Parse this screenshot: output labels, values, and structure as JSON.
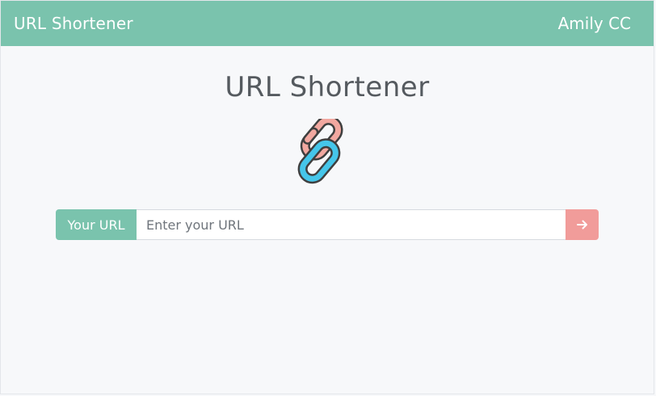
{
  "navbar": {
    "brand": "URL Shortener",
    "user_name": "Amily CC"
  },
  "main": {
    "title": "URL Shortener",
    "logo_icon": "chain-link-icon",
    "form": {
      "addon_label": "Your URL",
      "input_placeholder": "Enter your URL",
      "input_value": "",
      "submit_icon": "arrow-right-icon"
    }
  },
  "colors": {
    "navbar": "#7ac3ad",
    "submit": "#f19c9a",
    "link_blue": "#45c6ea",
    "link_pink": "#f2a8a0",
    "background": "#f7f8fa"
  }
}
